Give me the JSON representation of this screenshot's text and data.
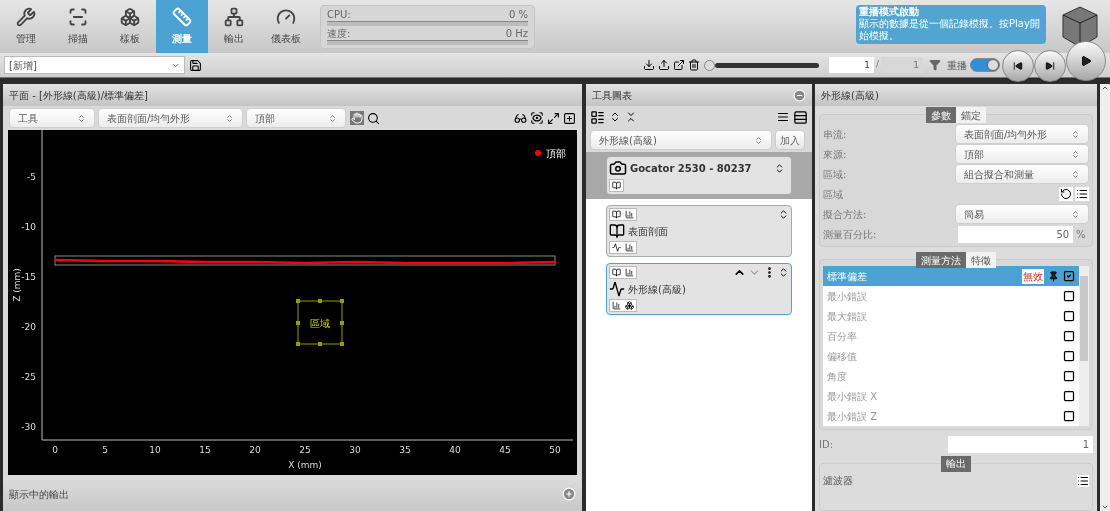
{
  "nav": [
    {
      "label": "管理",
      "selected": false
    },
    {
      "label": "掃描",
      "selected": false
    },
    {
      "label": "樣板",
      "selected": false
    },
    {
      "label": "測量",
      "selected": true
    },
    {
      "label": "輸出",
      "selected": false
    },
    {
      "label": "儀表板",
      "selected": false
    }
  ],
  "stats": [
    {
      "label": "CPU:",
      "reading": "0 %",
      "level": 0
    },
    {
      "label": "速度:",
      "reading": "0 Hz",
      "level": 0
    }
  ],
  "notice": {
    "title": "重播模式啟動",
    "message": "顯示的數據是從一個記錄模擬。按Play開始模擬。"
  },
  "toolbar": {
    "job": "[新增]",
    "frame": "1",
    "separator": "/",
    "total": "1",
    "replay_label": "重播",
    "replay_on": true,
    "seek": {
      "level": 0
    }
  },
  "view_panel": {
    "title": "平面 - [外形線(高級)/標準偏差]",
    "selects": [
      "工具",
      "表面剖面/均勻外形",
      "頂部"
    ],
    "chart_data": {
      "type": "line",
      "xlabel": "X (mm)",
      "ylabel": "Z (mm)",
      "x": [
        0,
        5,
        10,
        15,
        20,
        25,
        30,
        35,
        40,
        45,
        50
      ],
      "series": [
        {
          "name": "頂部",
          "color": "#ff0000",
          "values": [
            -13.3,
            -13.4,
            -13.4,
            -13.5,
            -13.5,
            -13.6,
            -13.5,
            -13.6,
            -13.6,
            -13.6,
            -13.5
          ]
        }
      ],
      "xlim": [
        -4.7,
        52
      ],
      "ylim": [
        -31.3,
        -0.3
      ],
      "xticks": [
        0,
        5,
        10,
        15,
        20,
        25,
        30,
        35,
        40,
        45,
        50
      ],
      "yticks": [
        -5,
        -10,
        -15,
        -20,
        -25,
        -30
      ],
      "annotations": [
        {
          "text": "區域",
          "x": 26.5,
          "y": -19.6
        }
      ]
    },
    "footer": "顯示中的輸出"
  },
  "tool_panel": {
    "title": "工具圖表",
    "select": "外形線(高級)",
    "add_button": "加入",
    "nodes": [
      {
        "kind": "sensor",
        "title": "Gocator 2530 - 80237",
        "selected": false
      },
      {
        "kind": "tool",
        "title": "表面剖面",
        "selected": false
      },
      {
        "kind": "tool",
        "title": "外形線(高級)",
        "selected": true
      }
    ]
  },
  "settings_panel": {
    "title": "外形線(高級)",
    "tabs": [
      {
        "label": "參數",
        "selected": true
      },
      {
        "label": "錨定",
        "selected": false
      }
    ],
    "fields": [
      {
        "kind": "select",
        "label": "串流:",
        "value": "表面剖面/均勻外形"
      },
      {
        "kind": "select",
        "label": "來源:",
        "value": "頂部"
      },
      {
        "kind": "select",
        "label": "區域:",
        "value": "組合擬合和測量"
      },
      {
        "kind": "buttons",
        "label": "區域"
      },
      {
        "kind": "select",
        "label": "擬合方法:",
        "value": "簡易"
      },
      {
        "kind": "input",
        "label": "測量百分比:",
        "value": "50",
        "unit": "%"
      }
    ],
    "measure_tabs": [
      {
        "label": "測量方法",
        "selected": true
      },
      {
        "label": "特徵",
        "selected": false
      }
    ],
    "measurements": [
      {
        "label": "標準偏差",
        "selected": true,
        "checked": true,
        "badge": "無效"
      },
      {
        "label": "最小錯誤",
        "selected": false,
        "checked": false
      },
      {
        "label": "最大錯誤",
        "selected": false,
        "checked": false
      },
      {
        "label": "百分率",
        "selected": false,
        "checked": false
      },
      {
        "label": "偏移值",
        "selected": false,
        "checked": false
      },
      {
        "label": "角度",
        "selected": false,
        "checked": false
      },
      {
        "label": "最小錯誤 X",
        "selected": false,
        "checked": false
      },
      {
        "label": "最小錯誤 Z",
        "selected": false,
        "checked": false
      }
    ],
    "id_label": "ID:",
    "id_value": "1",
    "output_tab": "輸出",
    "filter_label": "濾波器"
  }
}
